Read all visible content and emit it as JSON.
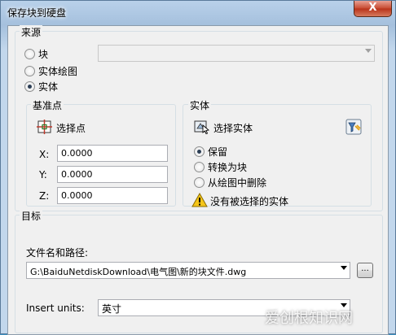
{
  "window": {
    "title": "保存块到硬盘",
    "close_label": "X"
  },
  "source": {
    "label": "来源",
    "options": [
      {
        "label": "块",
        "checked": false
      },
      {
        "label": "实体绘图",
        "checked": false
      },
      {
        "label": "实体",
        "checked": true
      }
    ],
    "block_combo_value": ""
  },
  "base_point": {
    "label": "基准点",
    "pick_label": "选择点",
    "x_label": "X:",
    "x_value": "0.0000",
    "y_label": "Y:",
    "y_value": "0.0000",
    "z_label": "Z:",
    "z_value": "0.0000"
  },
  "entity": {
    "label": "实体",
    "select_label": "选择实体",
    "options": [
      {
        "label": "保留",
        "checked": true
      },
      {
        "label": "转换为块",
        "checked": false
      },
      {
        "label": "从绘图中删除",
        "checked": false
      }
    ],
    "warning": "没有被选择的实体"
  },
  "target": {
    "label": "目标",
    "path_label": "文件名和路径:",
    "path_value": "G:\\BaiduNetdiskDownload\\电气图\\新的块文件.dwg",
    "browse_label": "...",
    "units_label": "Insert units:",
    "units_value": "英寸"
  },
  "watermark": "爱创根知识网",
  "colors": {
    "title_bar": "#b9d1ea",
    "close_button": "#c7492f",
    "dialog_bg": "#f0f0f0"
  }
}
